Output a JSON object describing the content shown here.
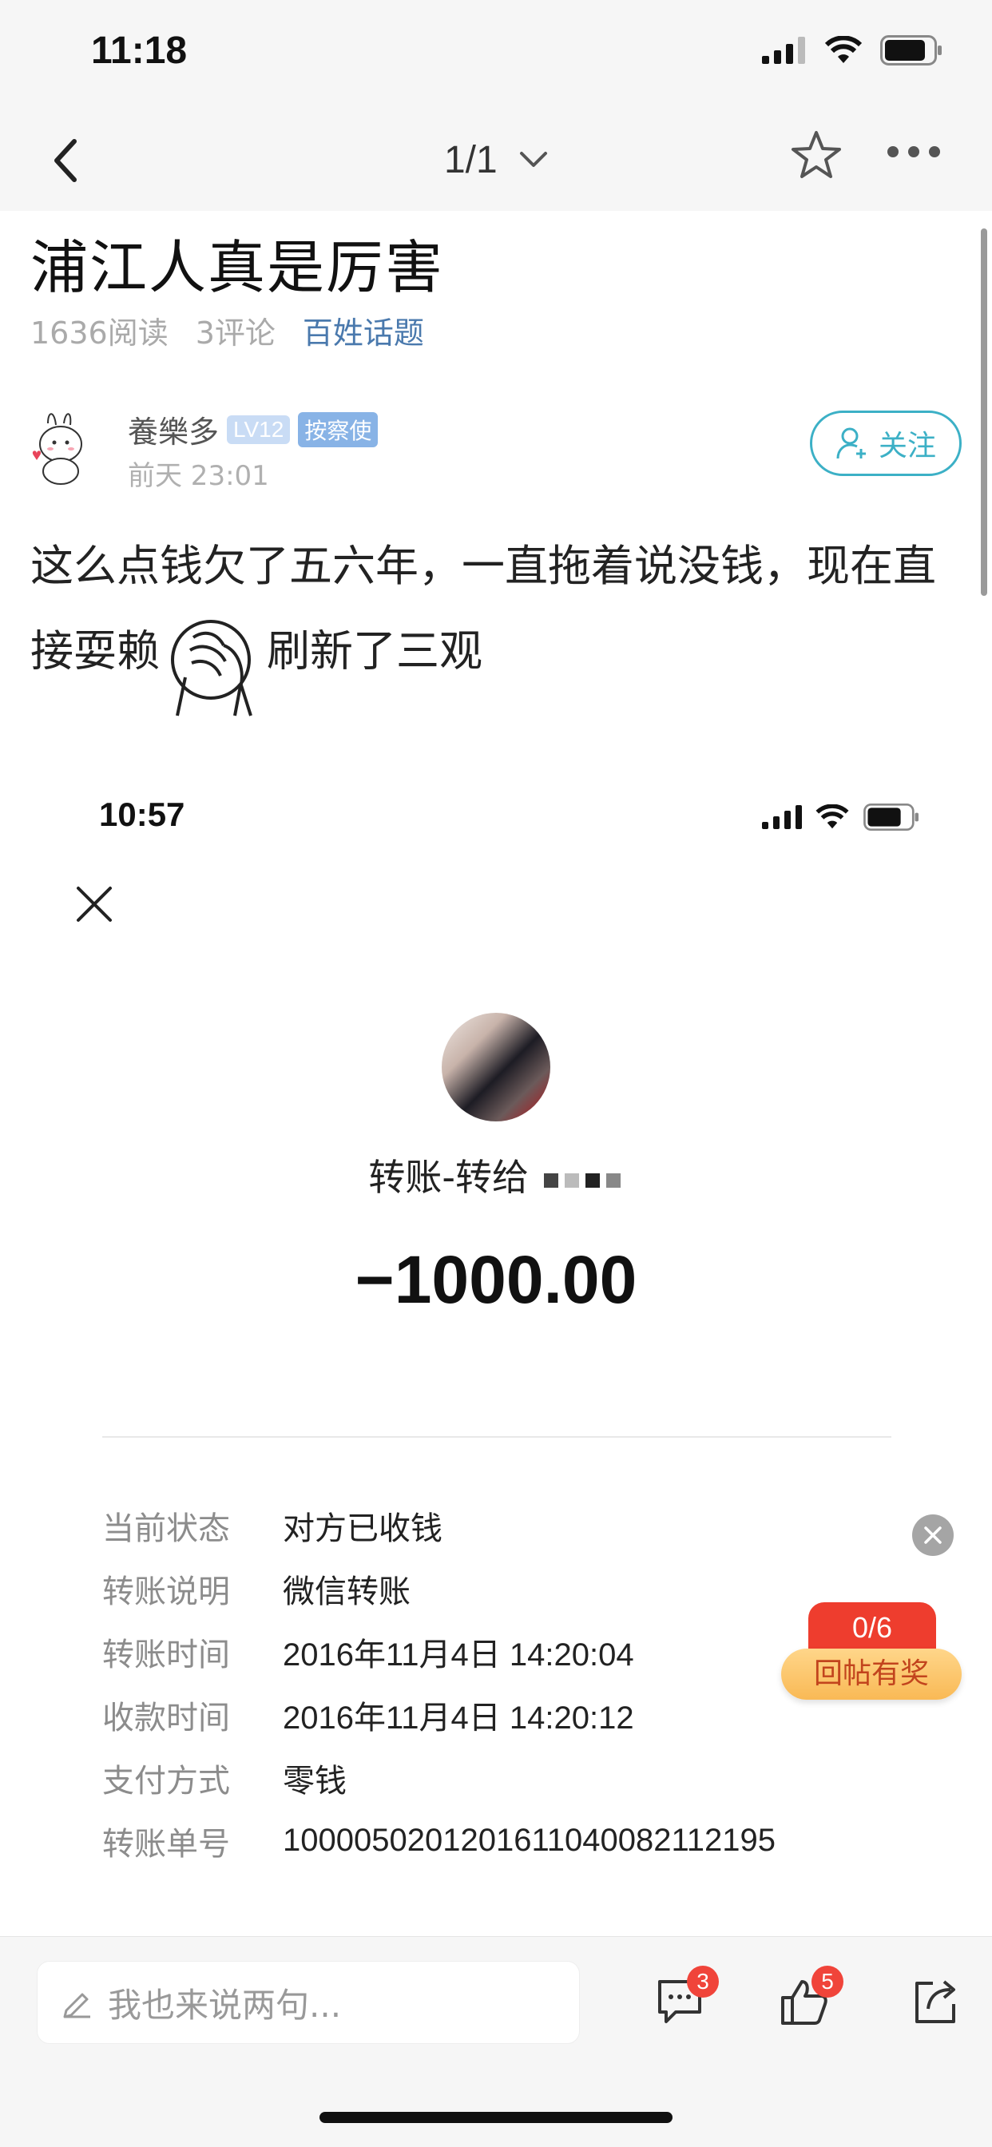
{
  "status_bar": {
    "time": "11:18"
  },
  "nav": {
    "page_indicator": "1/1"
  },
  "article": {
    "title": "浦江人真是厉害",
    "reads": "1636阅读",
    "comments": "3评论",
    "topic": "百姓话题",
    "author": {
      "name": "養樂多",
      "level": "LV12",
      "role_badge": "按察使",
      "time": "前天 23:01"
    },
    "follow_label": "关注",
    "body_line1": "这么点钱欠了五六年，一直拖着说没钱，现在直",
    "body_line2_before": "接耍赖",
    "body_line2_after": "刷新了三观"
  },
  "embedded_screenshot": {
    "time": "10:57",
    "title": "转账-转给",
    "amount": "−1000.00",
    "details": [
      {
        "key": "当前状态",
        "value": "对方已收钱"
      },
      {
        "key": "转账说明",
        "value": "微信转账"
      },
      {
        "key": "转账时间",
        "value": "2016年11月4日 14:20:04"
      },
      {
        "key": "收款时间",
        "value": "2016年11月4日 14:20:12"
      },
      {
        "key": "支付方式",
        "value": "零钱"
      },
      {
        "key": "转账单号",
        "value": "1000050201201611040082112195"
      }
    ]
  },
  "reward_widget": {
    "count": "0/6",
    "label": "回帖有奖"
  },
  "bottom_bar": {
    "comment_placeholder": "我也来说两句...",
    "comment_badge": "3",
    "like_badge": "5"
  },
  "colors": {
    "accent": "#3cb0c6",
    "topic": "#4a79ad",
    "badge_red": "#f0443a",
    "reward_orange": "#f9b955"
  }
}
